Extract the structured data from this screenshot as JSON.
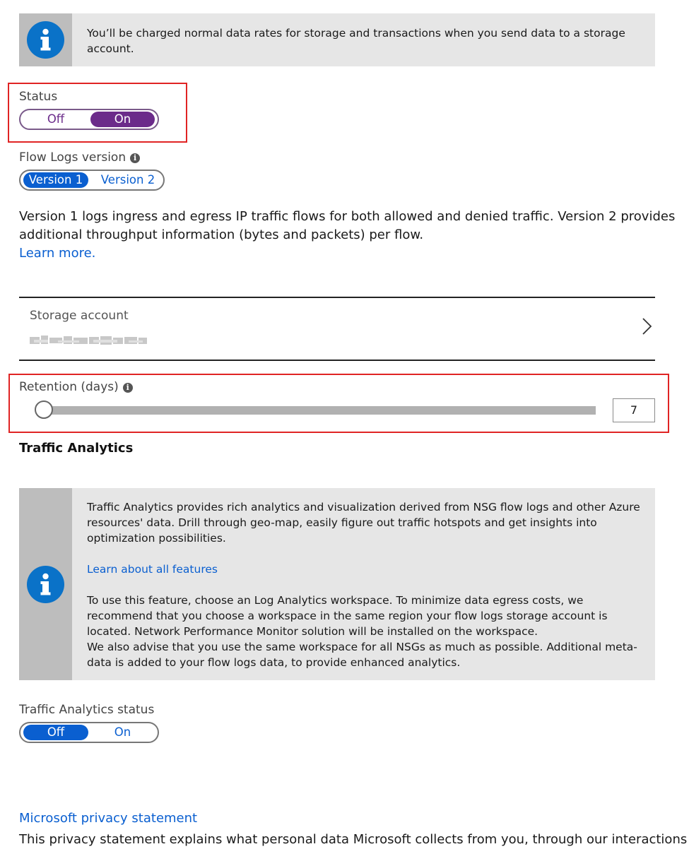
{
  "storage_notice": "You’ll be charged normal data rates for storage and transactions when you send data to a storage account.",
  "status": {
    "label": "Status",
    "options": [
      "Off",
      "On"
    ],
    "selected": "On"
  },
  "flow_logs_version": {
    "label": "Flow Logs version",
    "options": [
      "Version 1",
      "Version 2"
    ],
    "selected": "Version 1",
    "description_line1": "Version 1 logs ingress and egress IP traffic flows for both allowed and denied traffic. Version 2 provides",
    "description_line2": "additional throughput information (bytes and packets) per flow.",
    "learn_more": "Learn more."
  },
  "storage_account": {
    "label": "Storage account",
    "value_redacted": true
  },
  "retention": {
    "label": "Retention (days)",
    "value": "7",
    "slider_fraction": 0.0
  },
  "traffic_analytics": {
    "heading": "Traffic Analytics",
    "info_para1": "Traffic Analytics provides rich analytics and visualization derived from NSG flow logs and other Azure resources' data. Drill through geo-map, easily figure out traffic hotspots and get insights into optimization possibilities.",
    "learn_link": "Learn about all features",
    "info_para2a": "To use this feature, choose an Log Analytics workspace. To minimize data egress costs, we recommend that you choose a workspace in the same region your flow logs storage account is located. Network Performance Monitor solution will be installed on the workspace.",
    "info_para2b": "We also advise that you use the same workspace for all NSGs as much as possible. Additional meta-data is added to your flow logs data, to provide enhanced analytics.",
    "status_label": "Traffic Analytics status",
    "options": [
      "Off",
      "On"
    ],
    "selected": "Off"
  },
  "privacy": {
    "link": "Microsoft privacy statement",
    "text": "This privacy statement explains what personal data Microsoft collects from you, through our interactions"
  },
  "colors": {
    "accent_blue": "#0a5fd0",
    "status_purple": "#6b2b8a",
    "highlight_red": "#e02424",
    "info_icon_blue": "#0a72c8"
  },
  "icons": [
    "info-circle-icon",
    "small-info-icon",
    "chevron-right-icon",
    "slider-thumb"
  ]
}
